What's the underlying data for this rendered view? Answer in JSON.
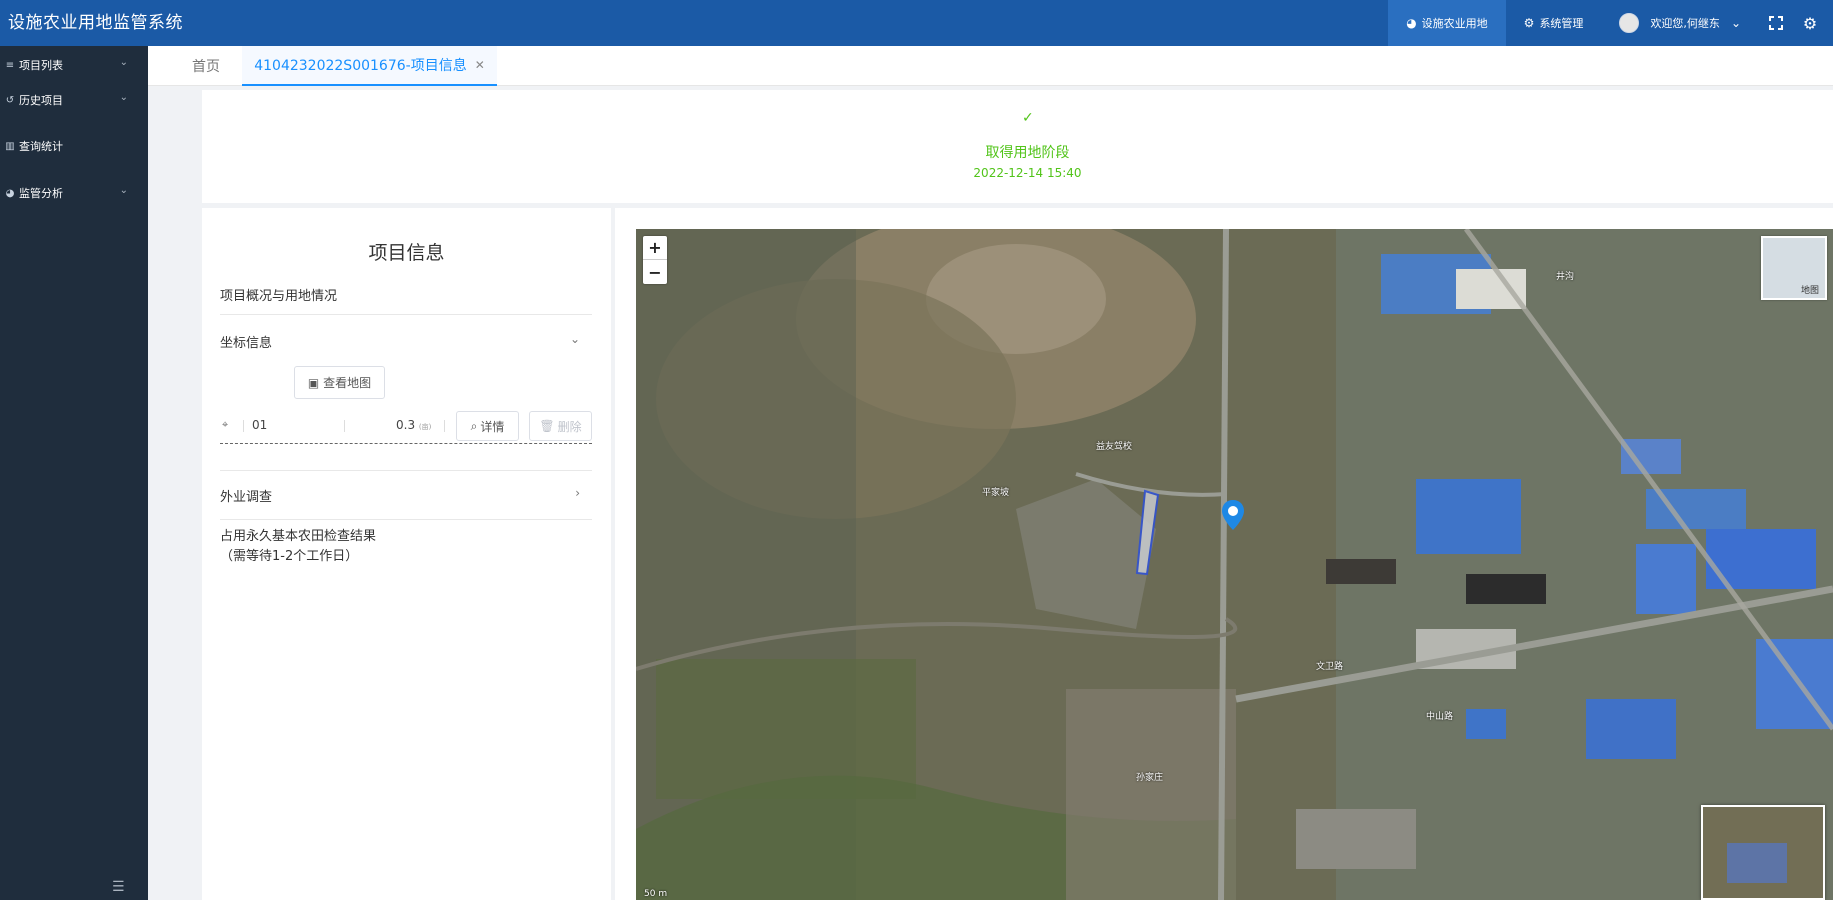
{
  "header": {
    "app_title": "设施农业用地监管系统",
    "nav": {
      "facility_land": "设施农业用地",
      "system_admin": "系统管理",
      "welcome": "欢迎您,何继东"
    }
  },
  "sidebar": {
    "items": [
      {
        "label": "项目列表"
      },
      {
        "label": "历史项目"
      },
      {
        "label": "查询统计"
      },
      {
        "label": "监管分析"
      }
    ]
  },
  "tabs": {
    "home": "首页",
    "active": "4104232022S001676-项目信息"
  },
  "stage": {
    "title": "取得用地阶段",
    "time": "2022-12-14 15:40"
  },
  "info": {
    "title": "项目信息",
    "overview": "项目概况与用地情况",
    "coords_section": "坐标信息",
    "view_map": "查看地图",
    "coord_id": "01",
    "coord_area": "0.3",
    "coord_unit": "(亩)",
    "detail_btn": "详情",
    "delete_btn": "删除",
    "field_survey": "外业调查",
    "farmland_check_line1": "占用永久基本农田检查结果",
    "farmland_check_line2": "（需等待1-2个工作日）"
  },
  "map": {
    "zoom_in": "+",
    "zoom_out": "−",
    "layer_label": "地图",
    "labels": {
      "school": "益友驾校",
      "place1": "平家坡",
      "road1": "文卫路",
      "place2": "孙家庄",
      "place3": "井沟",
      "road2": "中山路",
      "scale": "50 m"
    }
  },
  "colors": {
    "header_bg": "#1b5aa6",
    "sidebar_bg": "#1f2d3d",
    "accent": "#1890ff",
    "success": "#52c41a"
  }
}
